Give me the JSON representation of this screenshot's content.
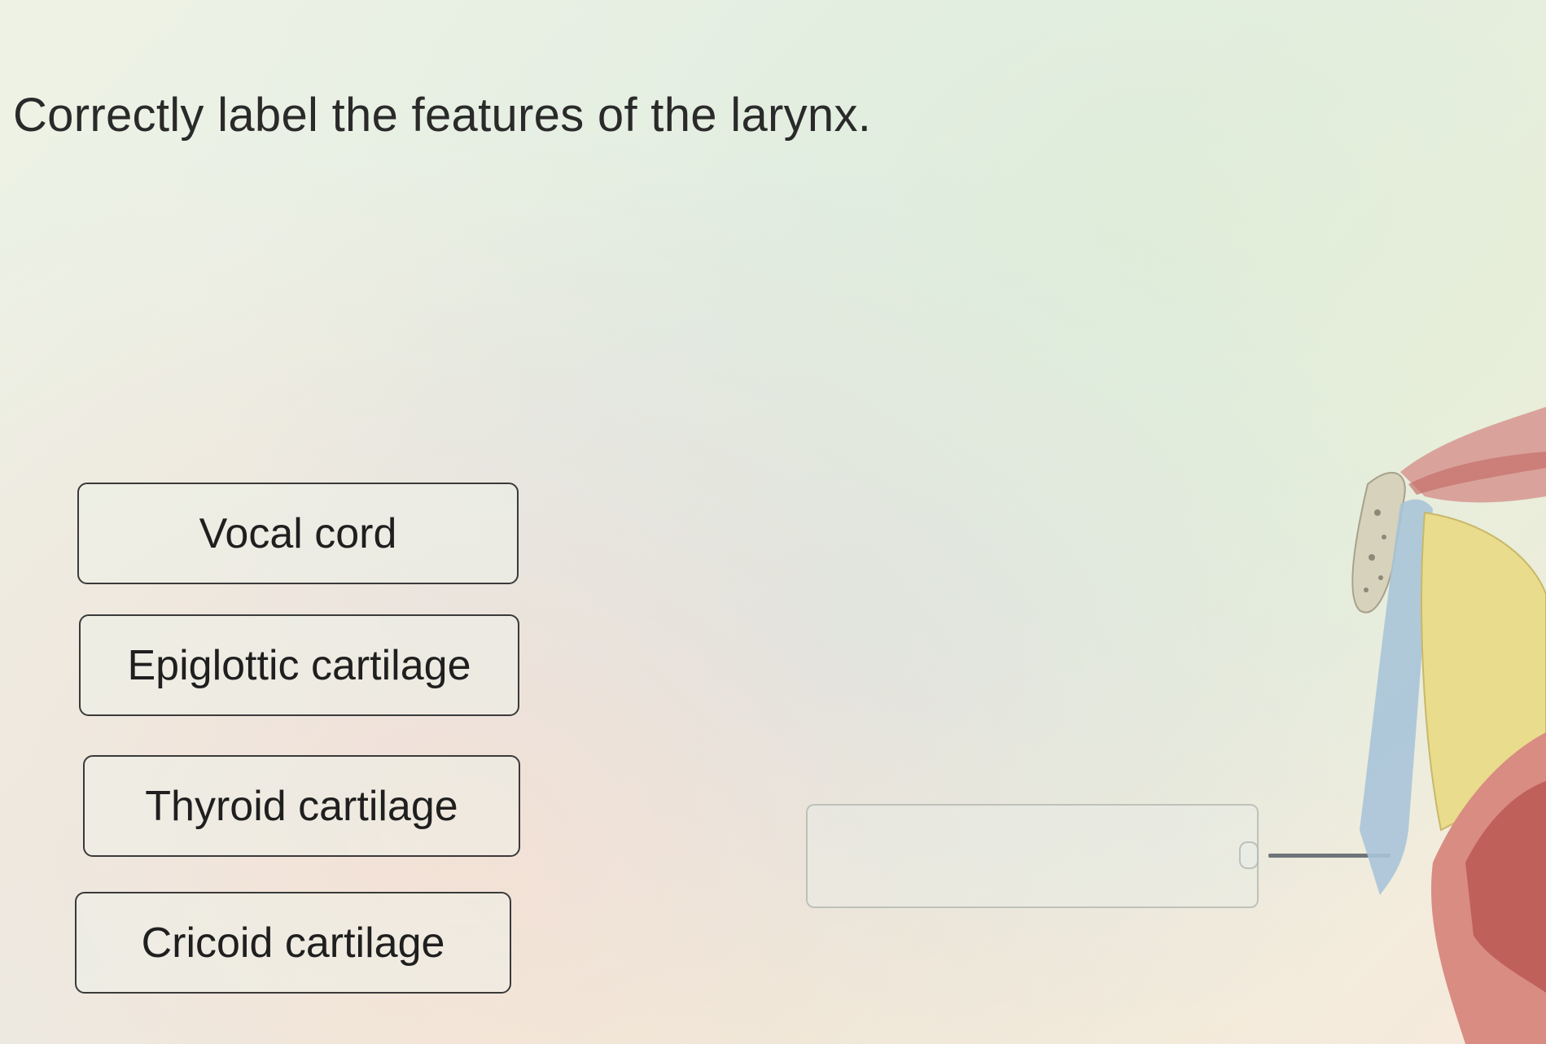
{
  "instruction": "Correctly label the features of the larynx.",
  "labels": [
    {
      "text": "Vocal cord"
    },
    {
      "text": "Epiglottic cartilage"
    },
    {
      "text": "Thyroid cartilage"
    },
    {
      "text": "Cricoid cartilage"
    }
  ],
  "drop_zone": {
    "value": ""
  },
  "colors": {
    "text": "#2a2a2a",
    "chip_border": "#3a3a3a",
    "leader_line": "#6e7478",
    "tissue_yellow": "#e9dc8c",
    "tissue_pink": "#d98c82",
    "tissue_blue": "#a9c4d8"
  }
}
